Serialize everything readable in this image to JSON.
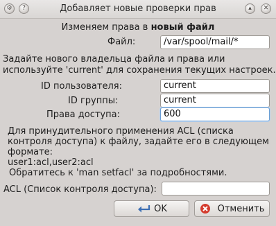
{
  "window": {
    "title": "Добавляет новые проверки прав",
    "controls": [
      "menu-icon",
      "help-icon",
      "maximize-icon",
      "close-icon"
    ]
  },
  "heading": {
    "prefix": "Изменяем права в",
    "bold": "новый файл"
  },
  "file": {
    "label": "Файл:",
    "value": "/var/spool/mail/*"
  },
  "intro": {
    "line1": "Задайте нового владельца файла и права или",
    "line2": "используйте 'current' для сохранения текущих настроек."
  },
  "user_id": {
    "label": "ID пользователя:",
    "value": "current"
  },
  "group_id": {
    "label": "ID группы:",
    "value": "current"
  },
  "permissions": {
    "label": "Права доступа:",
    "value": "600"
  },
  "acl_help": {
    "line1": "Для принудительного применения ACL (списка",
    "line2": "контроля доступа) к файлу, задайте его в следующем",
    "line3": "формате:",
    "line4": "user1:acl,user2:acl",
    "line5": "Обратитесь к 'man setfacl' за подробностями."
  },
  "acl": {
    "label": "ACL (Список контроля доступа):",
    "value": ""
  },
  "buttons": {
    "ok": "OK",
    "cancel": "Отменить"
  }
}
